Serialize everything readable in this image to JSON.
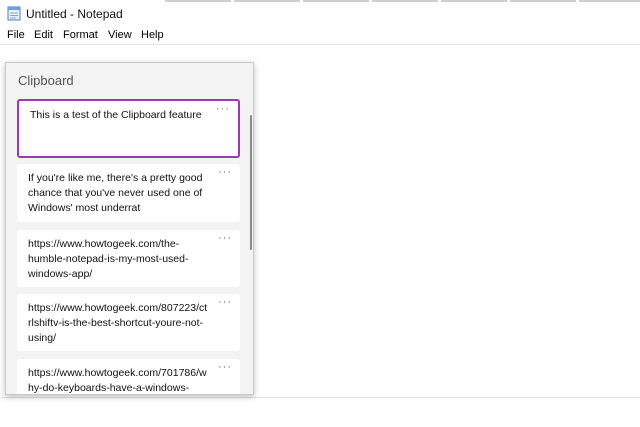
{
  "window": {
    "title": "Untitled - Notepad"
  },
  "menu": {
    "items": [
      "File",
      "Edit",
      "Format",
      "View",
      "Help"
    ]
  },
  "clipboard": {
    "title": "Clipboard",
    "items": [
      {
        "text": "This is a test of the Clipboard feature",
        "more": "···"
      },
      {
        "text": "If you're like me, there's a pretty good chance that you've never used one of Windows' most underrat",
        "more": "···"
      },
      {
        "text": "https://www.howtogeek.com/the-humble-notepad-is-my-most-used-windows-app/",
        "more": "···"
      },
      {
        "text": "https://www.howtogeek.com/807223/ctrlshiftv-is-the-best-shortcut-youre-not-using/",
        "more": "···"
      },
      {
        "text": "https://www.howtogeek.com/701786/why-do-keyboards-have-a-windows-",
        "more": "···"
      }
    ],
    "selected_index": 0,
    "accent_color": "#9b39b4"
  }
}
